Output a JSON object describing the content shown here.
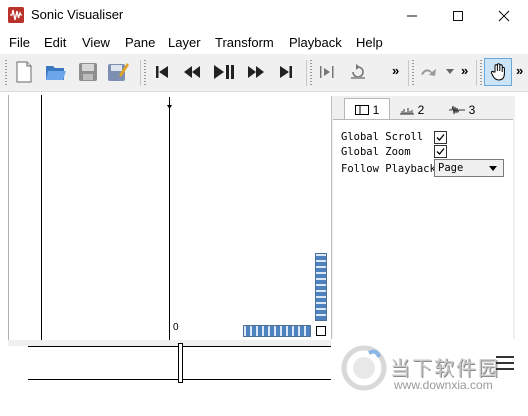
{
  "window": {
    "title": "Sonic Visualiser",
    "app_icon_label": "W"
  },
  "menu": {
    "items": [
      "File",
      "Edit",
      "View",
      "Pane",
      "Layer",
      "Transform",
      "Playback",
      "Help"
    ]
  },
  "toolbar": {
    "more_chevron": "»"
  },
  "panel": {
    "tabs": [
      "1",
      "2",
      "3"
    ],
    "global_scroll_label": "Global Scroll",
    "global_zoom_label": "Global Zoom",
    "follow_playback_label": "Follow Playback",
    "follow_playback_value": "Page",
    "global_scroll_checked": true,
    "global_zoom_checked": true
  },
  "pane": {
    "axis_zero_label": "0"
  },
  "watermark": {
    "text_cn": "当下软件园",
    "url": "www.downxia.com"
  }
}
